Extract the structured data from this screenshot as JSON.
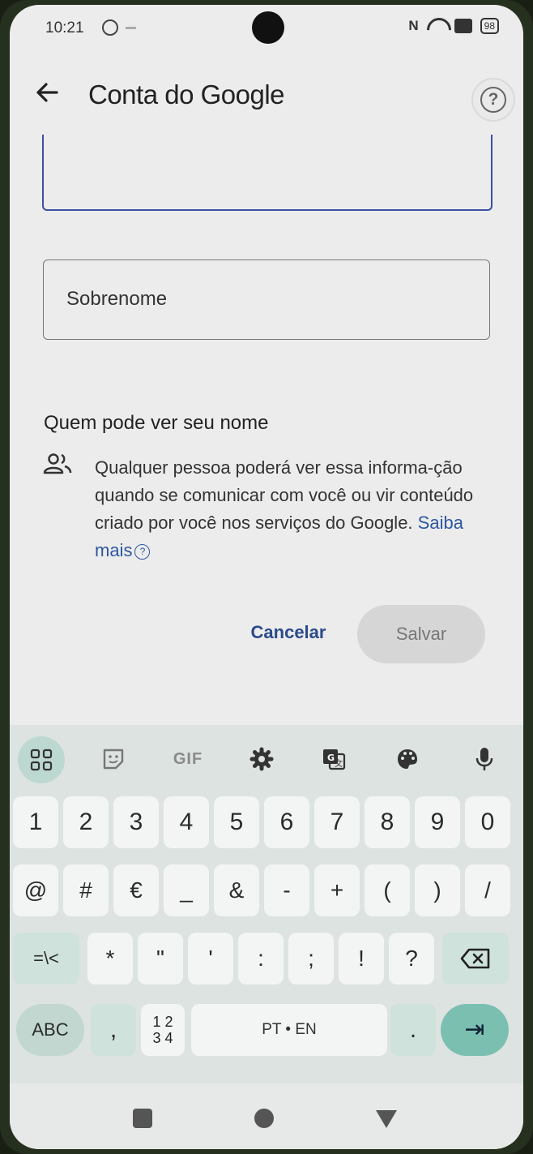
{
  "status_bar": {
    "time": "10:21",
    "battery": "98"
  },
  "app_bar": {
    "title": "Conta do Google",
    "back_icon": "arrow-left-icon",
    "help_icon": "help-circle-icon",
    "help_glyph": "?"
  },
  "form": {
    "first_name_value": "",
    "last_name_placeholder": "Sobrenome"
  },
  "visibility": {
    "title": "Quem pode ver seu nome",
    "icon": "people-icon",
    "body": "Qualquer pessoa poderá ver essa informa-ção quando se comunicar com você ou vir conteúdo criado por você nos serviços do Google.",
    "learn_more": "Saiba mais"
  },
  "actions": {
    "cancel_label": "Cancelar",
    "save_label": "Salvar"
  },
  "keyboard": {
    "toolbar": {
      "gif_label": "GIF"
    },
    "row1": [
      "1",
      "2",
      "3",
      "4",
      "5",
      "6",
      "7",
      "8",
      "9",
      "0"
    ],
    "row2": [
      "@",
      "#",
      "€",
      "_",
      "&",
      "-",
      "+",
      "(",
      ")",
      "/"
    ],
    "row3": [
      "=\\<",
      "*",
      "\"",
      "'",
      ":",
      ";",
      "!",
      "?"
    ],
    "row4": {
      "abc": "ABC",
      "comma": ",",
      "num_top": "1 2",
      "num_bottom": "3 4",
      "space": "PT • EN",
      "period": ".",
      "enter": "⇥"
    }
  },
  "colors": {
    "accent": "#3c4fa8",
    "link": "#2c56a0",
    "enter_key": "#7bbfb1"
  }
}
